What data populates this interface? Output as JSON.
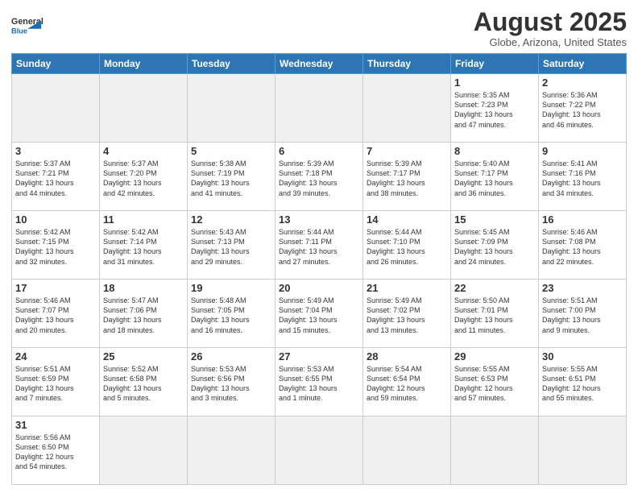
{
  "header": {
    "logo_general": "General",
    "logo_blue": "Blue",
    "month_year": "August 2025",
    "location": "Globe, Arizona, United States"
  },
  "weekdays": [
    "Sunday",
    "Monday",
    "Tuesday",
    "Wednesday",
    "Thursday",
    "Friday",
    "Saturday"
  ],
  "weeks": [
    [
      {
        "day": "",
        "info": "",
        "empty": true
      },
      {
        "day": "",
        "info": "",
        "empty": true
      },
      {
        "day": "",
        "info": "",
        "empty": true
      },
      {
        "day": "",
        "info": "",
        "empty": true
      },
      {
        "day": "",
        "info": "",
        "empty": true
      },
      {
        "day": "1",
        "info": "Sunrise: 5:35 AM\nSunset: 7:23 PM\nDaylight: 13 hours\nand 47 minutes."
      },
      {
        "day": "2",
        "info": "Sunrise: 5:36 AM\nSunset: 7:22 PM\nDaylight: 13 hours\nand 46 minutes."
      }
    ],
    [
      {
        "day": "3",
        "info": "Sunrise: 5:37 AM\nSunset: 7:21 PM\nDaylight: 13 hours\nand 44 minutes."
      },
      {
        "day": "4",
        "info": "Sunrise: 5:37 AM\nSunset: 7:20 PM\nDaylight: 13 hours\nand 42 minutes."
      },
      {
        "day": "5",
        "info": "Sunrise: 5:38 AM\nSunset: 7:19 PM\nDaylight: 13 hours\nand 41 minutes."
      },
      {
        "day": "6",
        "info": "Sunrise: 5:39 AM\nSunset: 7:18 PM\nDaylight: 13 hours\nand 39 minutes."
      },
      {
        "day": "7",
        "info": "Sunrise: 5:39 AM\nSunset: 7:17 PM\nDaylight: 13 hours\nand 38 minutes."
      },
      {
        "day": "8",
        "info": "Sunrise: 5:40 AM\nSunset: 7:17 PM\nDaylight: 13 hours\nand 36 minutes."
      },
      {
        "day": "9",
        "info": "Sunrise: 5:41 AM\nSunset: 7:16 PM\nDaylight: 13 hours\nand 34 minutes."
      }
    ],
    [
      {
        "day": "10",
        "info": "Sunrise: 5:42 AM\nSunset: 7:15 PM\nDaylight: 13 hours\nand 32 minutes."
      },
      {
        "day": "11",
        "info": "Sunrise: 5:42 AM\nSunset: 7:14 PM\nDaylight: 13 hours\nand 31 minutes."
      },
      {
        "day": "12",
        "info": "Sunrise: 5:43 AM\nSunset: 7:13 PM\nDaylight: 13 hours\nand 29 minutes."
      },
      {
        "day": "13",
        "info": "Sunrise: 5:44 AM\nSunset: 7:11 PM\nDaylight: 13 hours\nand 27 minutes."
      },
      {
        "day": "14",
        "info": "Sunrise: 5:44 AM\nSunset: 7:10 PM\nDaylight: 13 hours\nand 26 minutes."
      },
      {
        "day": "15",
        "info": "Sunrise: 5:45 AM\nSunset: 7:09 PM\nDaylight: 13 hours\nand 24 minutes."
      },
      {
        "day": "16",
        "info": "Sunrise: 5:46 AM\nSunset: 7:08 PM\nDaylight: 13 hours\nand 22 minutes."
      }
    ],
    [
      {
        "day": "17",
        "info": "Sunrise: 5:46 AM\nSunset: 7:07 PM\nDaylight: 13 hours\nand 20 minutes."
      },
      {
        "day": "18",
        "info": "Sunrise: 5:47 AM\nSunset: 7:06 PM\nDaylight: 13 hours\nand 18 minutes."
      },
      {
        "day": "19",
        "info": "Sunrise: 5:48 AM\nSunset: 7:05 PM\nDaylight: 13 hours\nand 16 minutes."
      },
      {
        "day": "20",
        "info": "Sunrise: 5:49 AM\nSunset: 7:04 PM\nDaylight: 13 hours\nand 15 minutes."
      },
      {
        "day": "21",
        "info": "Sunrise: 5:49 AM\nSunset: 7:02 PM\nDaylight: 13 hours\nand 13 minutes."
      },
      {
        "day": "22",
        "info": "Sunrise: 5:50 AM\nSunset: 7:01 PM\nDaylight: 13 hours\nand 11 minutes."
      },
      {
        "day": "23",
        "info": "Sunrise: 5:51 AM\nSunset: 7:00 PM\nDaylight: 13 hours\nand 9 minutes."
      }
    ],
    [
      {
        "day": "24",
        "info": "Sunrise: 5:51 AM\nSunset: 6:59 PM\nDaylight: 13 hours\nand 7 minutes."
      },
      {
        "day": "25",
        "info": "Sunrise: 5:52 AM\nSunset: 6:58 PM\nDaylight: 13 hours\nand 5 minutes."
      },
      {
        "day": "26",
        "info": "Sunrise: 5:53 AM\nSunset: 6:56 PM\nDaylight: 13 hours\nand 3 minutes."
      },
      {
        "day": "27",
        "info": "Sunrise: 5:53 AM\nSunset: 6:55 PM\nDaylight: 13 hours\nand 1 minute."
      },
      {
        "day": "28",
        "info": "Sunrise: 5:54 AM\nSunset: 6:54 PM\nDaylight: 12 hours\nand 59 minutes."
      },
      {
        "day": "29",
        "info": "Sunrise: 5:55 AM\nSunset: 6:53 PM\nDaylight: 12 hours\nand 57 minutes."
      },
      {
        "day": "30",
        "info": "Sunrise: 5:55 AM\nSunset: 6:51 PM\nDaylight: 12 hours\nand 55 minutes."
      }
    ],
    [
      {
        "day": "31",
        "info": "Sunrise: 5:56 AM\nSunset: 6:50 PM\nDaylight: 12 hours\nand 54 minutes."
      },
      {
        "day": "",
        "info": "",
        "empty": true
      },
      {
        "day": "",
        "info": "",
        "empty": true
      },
      {
        "day": "",
        "info": "",
        "empty": true
      },
      {
        "day": "",
        "info": "",
        "empty": true
      },
      {
        "day": "",
        "info": "",
        "empty": true
      },
      {
        "day": "",
        "info": "",
        "empty": true
      }
    ]
  ]
}
